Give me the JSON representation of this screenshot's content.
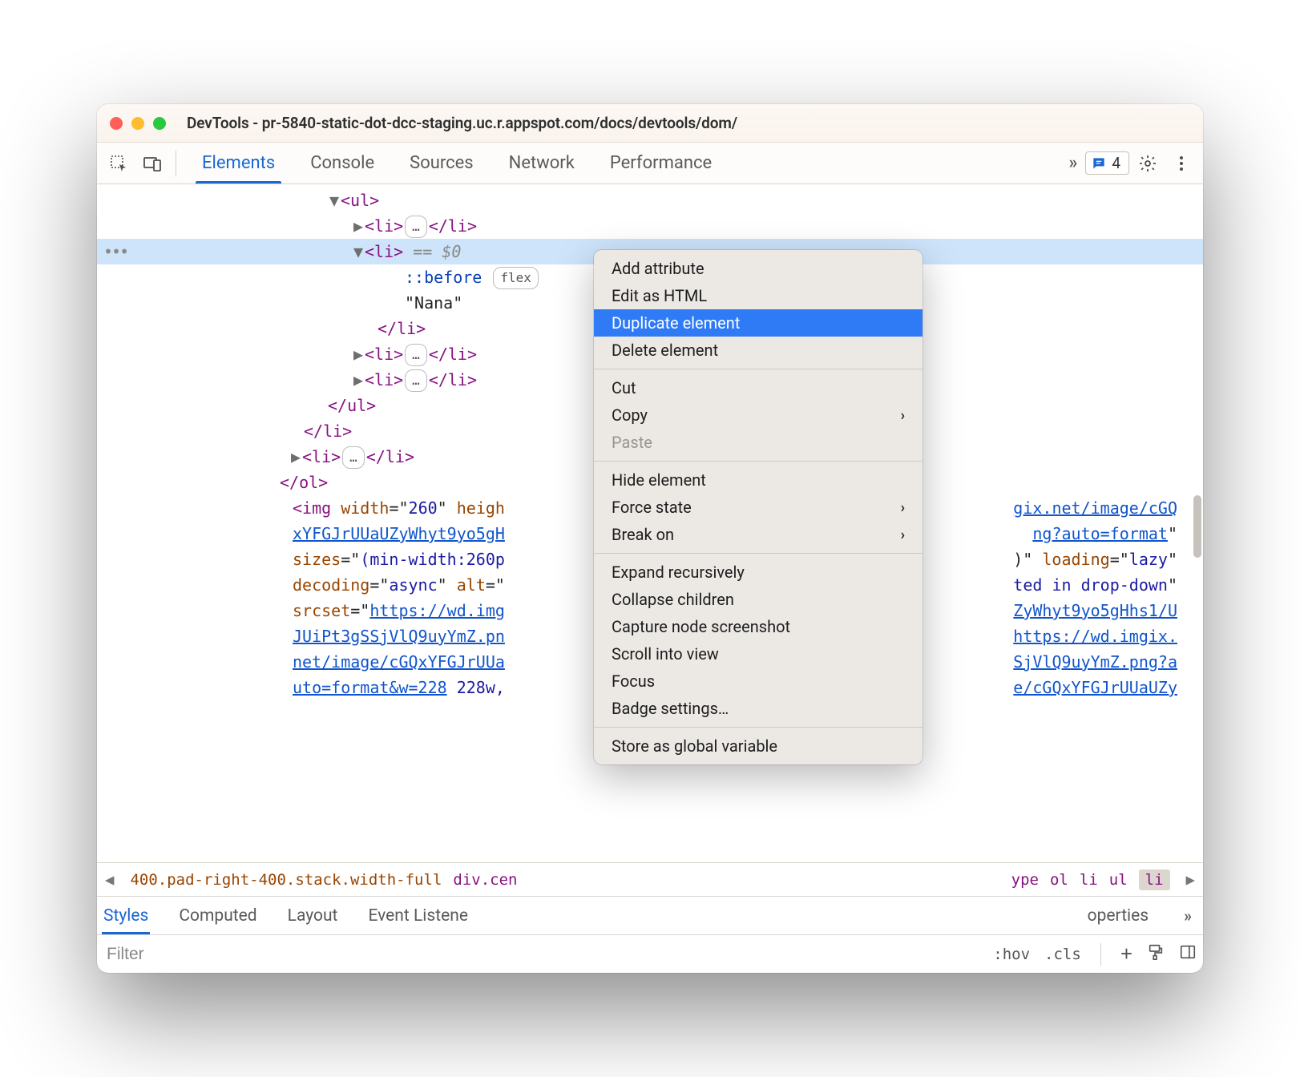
{
  "window": {
    "title": "DevTools - pr-5840-static-dot-dcc-staging.uc.r.appspot.com/docs/devtools/dom/"
  },
  "toolbar": {
    "tabs": [
      "Elements",
      "Console",
      "Sources",
      "Network",
      "Performance"
    ],
    "active_tab_index": 0,
    "issue_count": "4"
  },
  "dom": {
    "ul_open": "<ul>",
    "li_collapsed_open": "<li>",
    "li_collapsed_close": "</li>",
    "selected_li_open": "<li>",
    "selected_eq": " == $0",
    "pseudo_before": "::before",
    "flex_badge": "flex",
    "text_node": "\"Nana\"",
    "li_close": "</li>",
    "ul_close": "</ul>",
    "ol_close": "</ol>",
    "img_line1_prefix": "<img ",
    "img_width_name": "width",
    "img_width_val": "260",
    "img_height_name": "heigh",
    "img_link_line2": "xYFGJrUUaUZyWhyt9yo5gH",
    "img_link_suffix1": "gix.net/image/cGQ",
    "img_link_suffix2": "ng?auto=format",
    "sizes_name": "sizes",
    "sizes_val": "(min-width:260p",
    "sizes_tail": ")\" ",
    "loading_name": "loading",
    "loading_val": "lazy",
    "decoding_name": "decoding",
    "decoding_val": "async",
    "alt_name": "alt",
    "alt_tail": "ted in drop-down",
    "srcset_name": "srcset",
    "srcset_link1": "https://wd.img",
    "srcset_tail1": "ZyWhyt9yo5gHhs1/U",
    "srcset_link2": "JUiPt3gSSjVlQ9uyYmZ.pn",
    "srcset_tail2": "https://wd.imgix.",
    "srcset_link3": "net/image/cGQxYFGJrUUa",
    "srcset_tail3": "SjVlQ9uyYmZ.png?a",
    "srcset_link4": "uto=format&w=228",
    "srcset_228w": " 228w, ",
    "srcset_tail4": "e/cGQxYFGJrUUaUZy",
    "ellipsis_pill": "…"
  },
  "breadcrumb": {
    "class_chain": "400.pad-right-400.stack.width-full",
    "center": "div.cen",
    "trail": [
      "ype",
      "ol",
      "li",
      "ul",
      "li"
    ]
  },
  "styles_tabs": [
    "Styles",
    "Computed",
    "Layout",
    "Event Listene",
    "operties"
  ],
  "styles_active_index": 0,
  "filter": {
    "placeholder": "Filter",
    "hov": ":hov",
    "cls": ".cls"
  },
  "context_menu": {
    "items": [
      {
        "label": "Add attribute"
      },
      {
        "label": "Edit as HTML"
      },
      {
        "label": "Duplicate element",
        "highlight": true
      },
      {
        "label": "Delete element"
      },
      {
        "sep": true
      },
      {
        "label": "Cut"
      },
      {
        "label": "Copy",
        "submenu": true
      },
      {
        "label": "Paste",
        "disabled": true
      },
      {
        "sep": true
      },
      {
        "label": "Hide element"
      },
      {
        "label": "Force state",
        "submenu": true
      },
      {
        "label": "Break on",
        "submenu": true
      },
      {
        "sep": true
      },
      {
        "label": "Expand recursively"
      },
      {
        "label": "Collapse children"
      },
      {
        "label": "Capture node screenshot"
      },
      {
        "label": "Scroll into view"
      },
      {
        "label": "Focus"
      },
      {
        "label": "Badge settings…"
      },
      {
        "sep": true
      },
      {
        "label": "Store as global variable"
      }
    ]
  }
}
